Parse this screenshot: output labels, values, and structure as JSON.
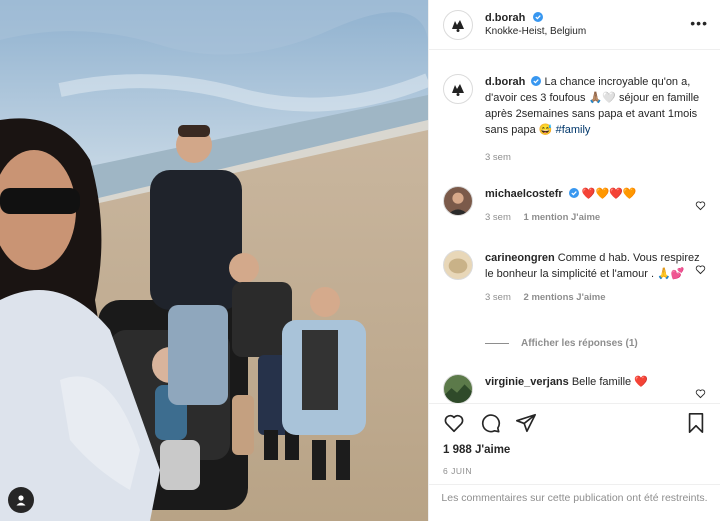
{
  "post": {
    "username": "d.borah",
    "location": "Knokke-Heist, Belgium",
    "more_icon": "ellipsis-icon",
    "caption": {
      "username": "d.borah",
      "text": "La chance incroyable qu'on a, d'avoir ces 3 foufous 🙏🏽🤍 séjour en famille après 2semaines sans papa et avant 1mois sans papa 😅",
      "hashtag": "#family",
      "time": "3 sem"
    },
    "comments": [
      {
        "username": "michaelcostefr",
        "text": "❤️🧡❤️🧡",
        "time": "3 sem",
        "likes": "1 mention J'aime",
        "verified": true
      },
      {
        "username": "carineongren",
        "text": "Comme d hab. Vous respirez le bonheur la simplicité et l'amour . 🙏💕",
        "time": "3 sem",
        "likes": "2 mentions J'aime"
      },
      {
        "username": "virginie_verjans",
        "text": "Belle famille ❤️"
      }
    ],
    "replies_label": "Afficher les réponses (1)",
    "like_count": "1 988 J'aime",
    "date": "6 JUIN",
    "restricted_notice": "Les commentaires sur cette publication ont été restreints."
  },
  "colors": {
    "verified": "#3897f0",
    "secondary_text": "#8e8e8e",
    "hashtag": "#00376b"
  }
}
